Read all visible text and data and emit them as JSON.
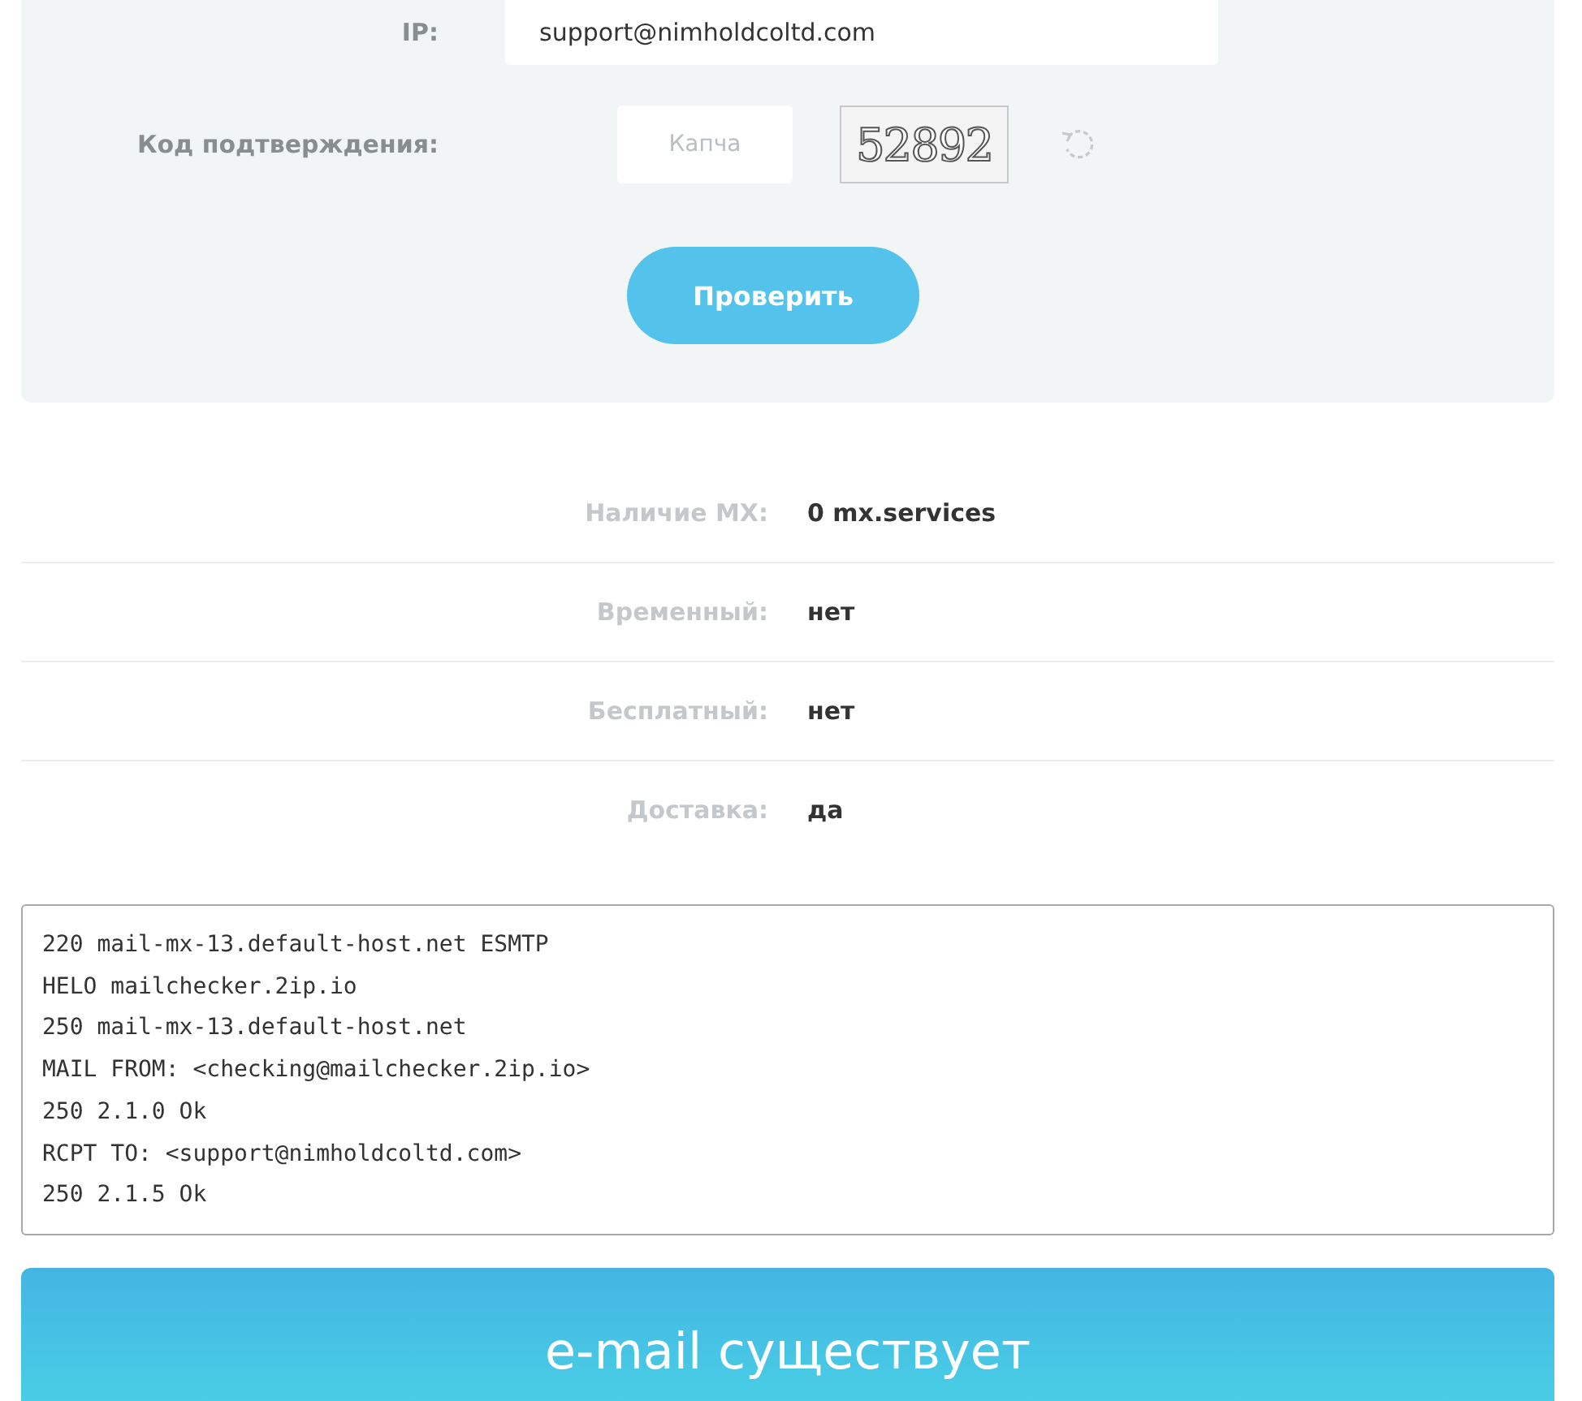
{
  "form": {
    "ip": {
      "label": "IP:",
      "value": "support@nimholdcoltd.com"
    },
    "captcha": {
      "label": "Код подтверждения:",
      "placeholder": "Капча",
      "code": "52892"
    },
    "submit": "Проверить"
  },
  "results": [
    {
      "label": "Наличие MX:",
      "value": "0 mx.services"
    },
    {
      "label": "Временный:",
      "value": "нет"
    },
    {
      "label": "Бесплатный:",
      "value": "нет"
    },
    {
      "label": "Доставка:",
      "value": "да"
    }
  ],
  "log": [
    "220 mail-mx-13.default-host.net ESMTP",
    "HELO mailchecker.2ip.io",
    "250 mail-mx-13.default-host.net",
    "MAIL FROM: <checking@mailchecker.2ip.io>",
    "250 2.1.0 Ok",
    "RCPT TO: <support@nimholdcoltd.com>",
    "250 2.1.5 Ok"
  ],
  "verdict": "e-mail существует"
}
